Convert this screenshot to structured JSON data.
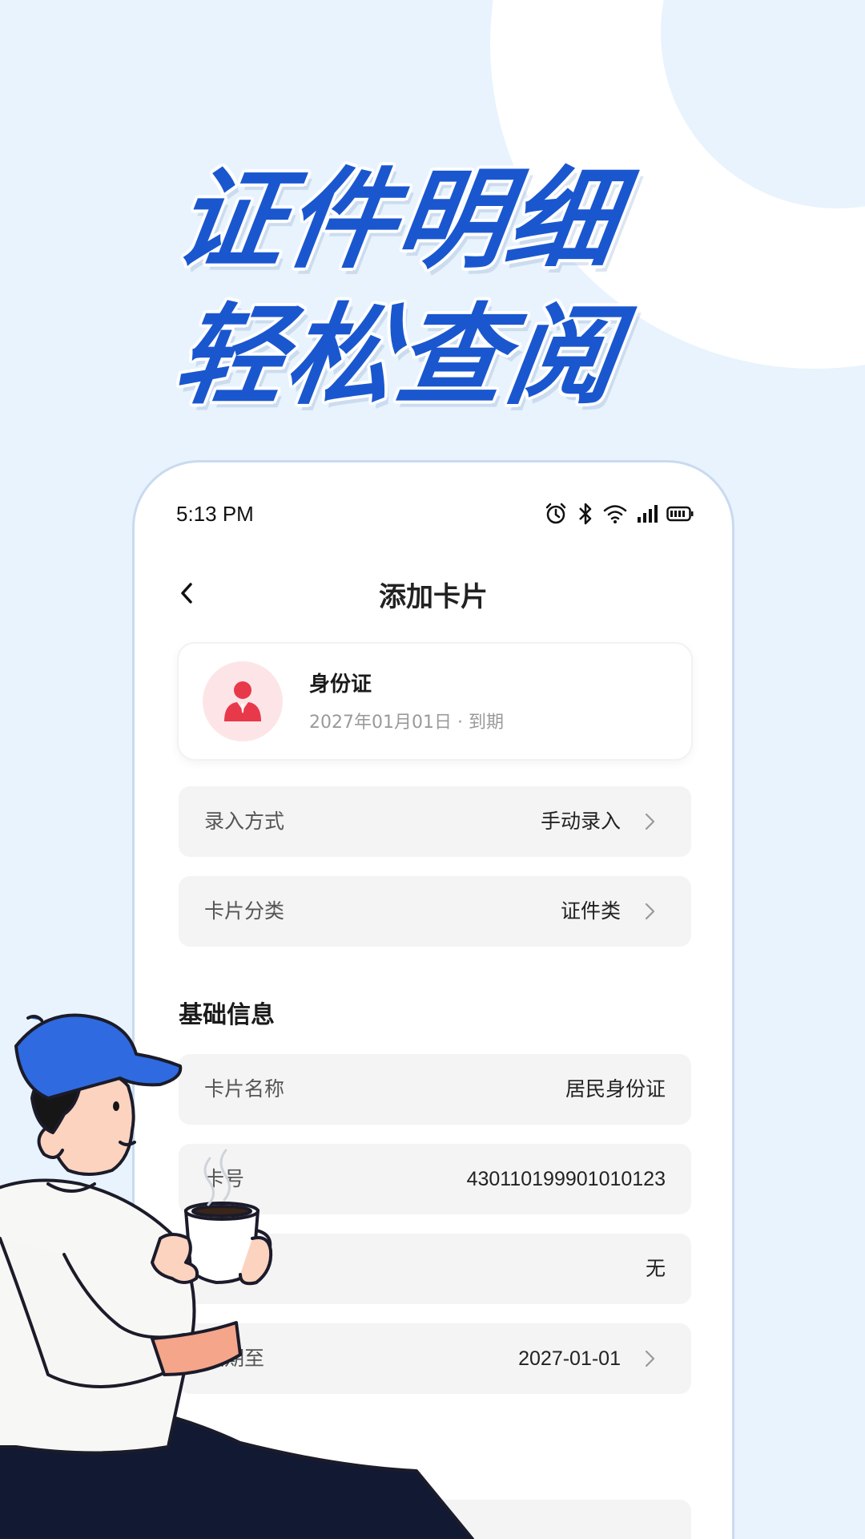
{
  "hero": {
    "line1": "证件明细",
    "line2": "轻松查阅"
  },
  "status_bar": {
    "time": "5:13 PM",
    "icons": [
      "alarm-icon",
      "bluetooth-icon",
      "wifi-icon",
      "signal-icon",
      "battery-icon"
    ]
  },
  "nav": {
    "back_icon": "chevron-left-icon",
    "title": "添加卡片"
  },
  "card_summary": {
    "icon": "person-icon",
    "name": "身份证",
    "expiry": "2027年01月01日 · 到期",
    "accent_color": "#e8394a"
  },
  "settings": [
    {
      "label": "录入方式",
      "value": "手动录入",
      "chevron": true
    },
    {
      "label": "卡片分类",
      "value": "证件类",
      "chevron": true
    }
  ],
  "basic_info": {
    "title": "基础信息",
    "fields": [
      {
        "label": "卡片名称",
        "value": "居民身份证",
        "chevron": false
      },
      {
        "label": "卡号",
        "value": "430110199901010123",
        "chevron": false
      },
      {
        "label": "",
        "value": "无",
        "chevron": false
      },
      {
        "label": "效期至",
        "value": "2027-01-01",
        "chevron": true
      }
    ]
  },
  "colors": {
    "hero_blue": "#1a57cf",
    "background": "#e8f3fd",
    "row_background": "#f4f4f4"
  }
}
